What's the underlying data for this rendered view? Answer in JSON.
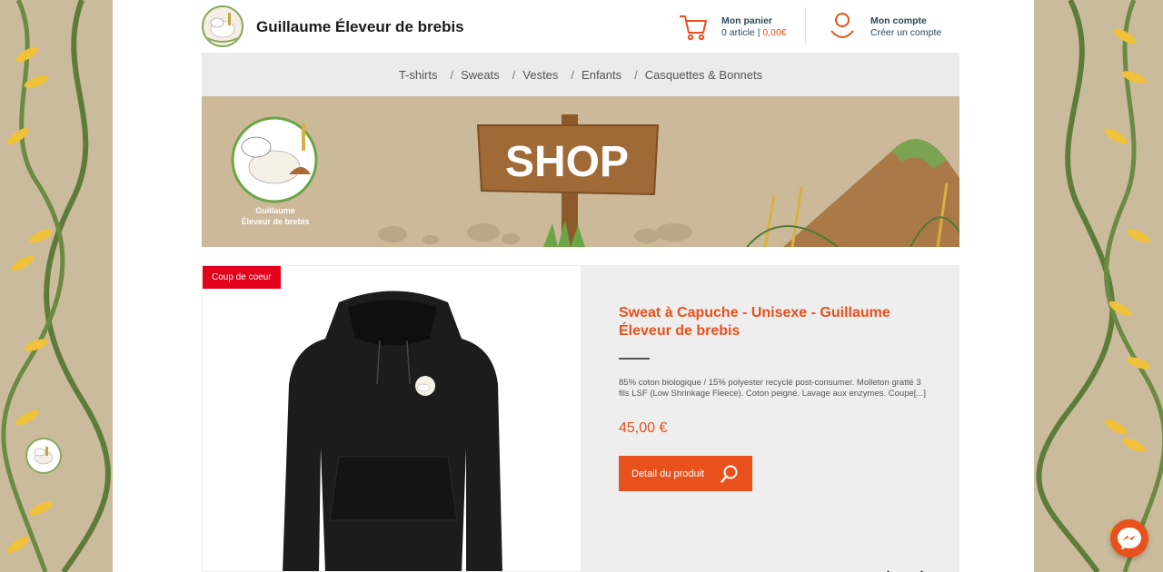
{
  "header": {
    "site_title": "Guillaume Éleveur de brebis",
    "cart": {
      "title": "Mon panier",
      "count": "0 article",
      "separator": "|",
      "total": "0,00€"
    },
    "account": {
      "title": "Mon compte",
      "link": "Créer un compte"
    }
  },
  "nav": {
    "items": [
      {
        "label": "T-shirts"
      },
      {
        "label": "Sweats"
      },
      {
        "label": "Vestes"
      },
      {
        "label": "Enfants"
      },
      {
        "label": "Casquettes & Bonnets"
      }
    ],
    "separator": "/"
  },
  "banner": {
    "sign_text": "SHOP",
    "logo_line1": "Guillaume",
    "logo_line2": "Éleveur de brebis"
  },
  "product": {
    "badge": "Coup de coeur",
    "title": "Sweat à Capuche - Unisexe - Guillaume Éleveur de brebis",
    "description": "85% coton biologique / 15% polyester recyclé post-consumer. Molleton gratté 3 fils LSF (Low Shrinkage Fleece). Coton peigné. Lavage aux enzymes. Coupe[...]",
    "price": "45,00 €",
    "button_label": "Detail du produit"
  },
  "colors": {
    "accent": "#e8511c",
    "badge": "#e3001b",
    "navy_text": "#2c4a5a",
    "beige_bg": "#cbb999",
    "nav_bg": "#ebebeb"
  },
  "icons": {
    "cart": "cart-icon",
    "account": "user-icon",
    "search": "search-icon",
    "messenger": "messenger-icon"
  }
}
